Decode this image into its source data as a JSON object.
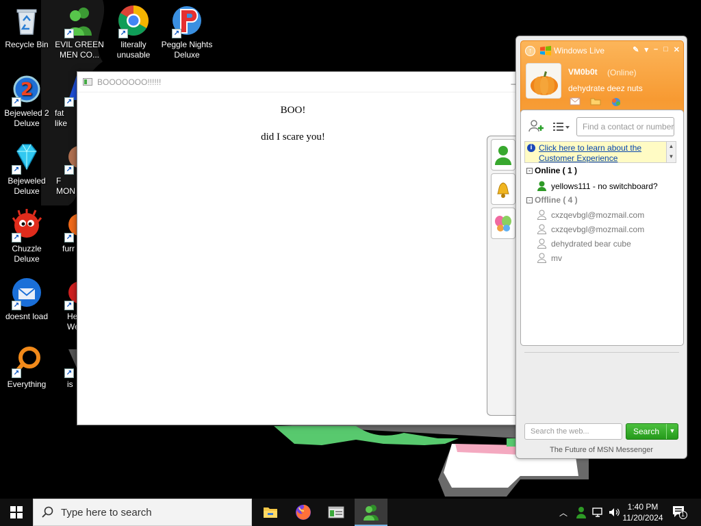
{
  "desktop": {
    "icons": [
      {
        "label": "Recycle Bin"
      },
      {
        "label": "EVIL GREEN MEN CO..."
      },
      {
        "label": "literally unusable"
      },
      {
        "label": "Peggle Nights Deluxe"
      },
      {
        "label": "Bejeweled 2 Deluxe"
      },
      {
        "label": "fat like"
      },
      {
        "label": "Bejeweled Deluxe"
      },
      {
        "label": "F MON"
      },
      {
        "label": "Chuzzle Deluxe"
      },
      {
        "label": "furr"
      },
      {
        "label": "doesnt load"
      },
      {
        "label": "He We"
      },
      {
        "label": "Everything"
      },
      {
        "label": "is"
      }
    ]
  },
  "boo_window": {
    "title": "BOOOOOOO!!!!!!",
    "line1": "BOO!",
    "line2": "did I scare you!"
  },
  "messenger": {
    "brand": "Windows Live",
    "username": "VM0b0t",
    "status": "(Online)",
    "personal_message": "dehydrate deez nuts",
    "find_placeholder": "Find a contact or number",
    "info_link": "Click here to learn about the Customer Experience",
    "groups": [
      {
        "label": "Online ( 1 )",
        "contacts": [
          "yellows111 - no switchboard?"
        ]
      },
      {
        "label": "Offline ( 4 )",
        "contacts": [
          "cxzqevbgl@mozmail.com",
          "cxzqevbgl@mozmail.com",
          "dehydrated bear cube",
          "mv"
        ]
      }
    ],
    "web_search_placeholder": "Search the web...",
    "search_button": "Search",
    "footer": "The Future of MSN Messenger"
  },
  "taskbar": {
    "search_placeholder": "Type here to search",
    "time": "1:40 PM",
    "date": "11/20/2024",
    "notification_count": "1"
  },
  "colors": {
    "msn_orange": "#f79a32",
    "search_green": "#259a1b",
    "taskbar": "#101010"
  }
}
